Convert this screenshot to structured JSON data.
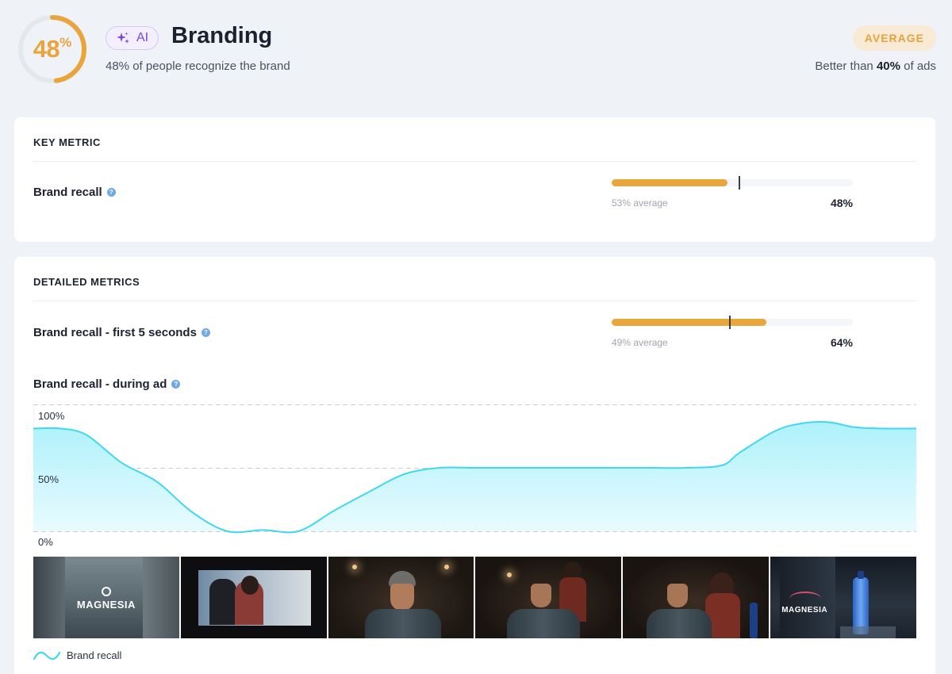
{
  "header": {
    "score_value": "48",
    "score_unit": "%",
    "score_fraction": 0.48,
    "ai_label": "AI",
    "title": "Branding",
    "subtitle": "48% of people recognize the brand",
    "rating": "AVERAGE",
    "better_prefix": "Better than ",
    "better_value": "40%",
    "better_suffix": " of ads"
  },
  "key_metric": {
    "heading": "KEY METRIC",
    "label": "Brand recall",
    "average_text": "53% average",
    "value_text": "48%",
    "value": 0.48,
    "average": 0.53
  },
  "detailed": {
    "heading": "DETAILED METRICS",
    "first5": {
      "label": "Brand recall - first 5 seconds",
      "average_text": "49% average",
      "value_text": "64%",
      "value": 0.64,
      "average": 0.49
    },
    "during": {
      "label": "Brand recall - during ad"
    }
  },
  "chart_data": {
    "type": "area",
    "title": "Brand recall - during ad",
    "y_ticks": [
      "100%",
      "50%",
      "0%"
    ],
    "ylim": [
      0,
      100
    ],
    "grid": true,
    "legend": "bottom-left",
    "series": [
      {
        "name": "Brand recall",
        "color": "#3fd8ee",
        "x": [
          0,
          3,
          6,
          10,
          14,
          18,
          22,
          26,
          30,
          34,
          38,
          42,
          46,
          50,
          54,
          58,
          62,
          66,
          70,
          74,
          78,
          80,
          84,
          87,
          90,
          93,
          96,
          100
        ],
        "values": [
          81,
          81,
          76,
          54,
          39,
          15,
          0,
          1,
          0,
          16,
          31,
          45,
          50,
          50,
          50,
          50,
          50,
          50,
          50,
          50,
          52,
          62,
          79,
          85,
          86,
          82,
          81,
          81
        ]
      }
    ]
  },
  "thumbnails": [
    {
      "name": "thumb-street-logo",
      "logo": "MAGNESIA",
      "bg": "#5a6770"
    },
    {
      "name": "thumb-couple",
      "logo": "",
      "bg": "#3a4a5a"
    },
    {
      "name": "thumb-man-beanie",
      "logo": "",
      "bg": "#2a2018"
    },
    {
      "name": "thumb-man-woman",
      "logo": "",
      "bg": "#251c16"
    },
    {
      "name": "thumb-couple-bottle",
      "logo": "",
      "bg": "#2a201a"
    },
    {
      "name": "thumb-bottle-logo",
      "logo": "MAGNESIA",
      "bg": "#202a36"
    }
  ],
  "legend_label": "Brand recall",
  "colors": {
    "accent": "#e8a63c",
    "chart_line": "#3fd8ee",
    "ai_purple": "#7a46e0"
  }
}
